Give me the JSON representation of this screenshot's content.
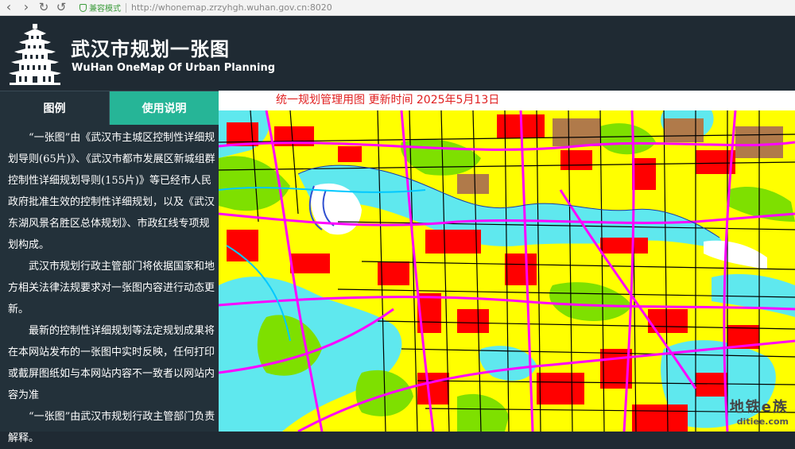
{
  "browser": {
    "back_glyph": "‹",
    "forward_glyph": "›",
    "reload_glyph": "↻",
    "undo_glyph": "↺",
    "secure_label": "兼容模式",
    "url": "http://whonemap.zrzyhgh.wuhan.gov.cn:8020"
  },
  "header": {
    "title_cn": "武汉市规划一张图",
    "title_en": "WuHan OneMap Of Urban Planning"
  },
  "tabs": [
    {
      "label": "图例"
    },
    {
      "label": "使用说明"
    }
  ],
  "instructions": [
    "“一张图”由《武汉市主城区控制性详细规划导则(65片)》、《武汉市都市发展区新城组群控制性详细规划导则(155片)》等已经市人民政府批准生效的控制性详细规划，以及《武汉东湖风景名胜区总体规划》、市政红线专项规划构成。",
    "武汉市规划行政主管部门将依据国家和地方相关法律法规要求对一张图内容进行动态更新。",
    "最新的控制性详细规划等法定规划成果将在本网站发布的一张图中实时反映，任何打印或截屏图纸如与本网站内容不一致者以网站内容为准",
    "“一张图”由武汉市规划行政主管部门负责解释。"
  ],
  "map": {
    "caption": "统一规划管理用图 更新时间 2025年5月13日",
    "colors": {
      "residential": "#ffff00",
      "commercial": "#ff0000",
      "industrial": "#b07a4a",
      "green": "#7ee000",
      "water": "#5fe8ee",
      "road": "#ff00ff",
      "road_minor": "#000000",
      "open": "#f2f2f2"
    }
  },
  "watermark": {
    "cn": "地铁e族",
    "en": "ditiee.com"
  }
}
